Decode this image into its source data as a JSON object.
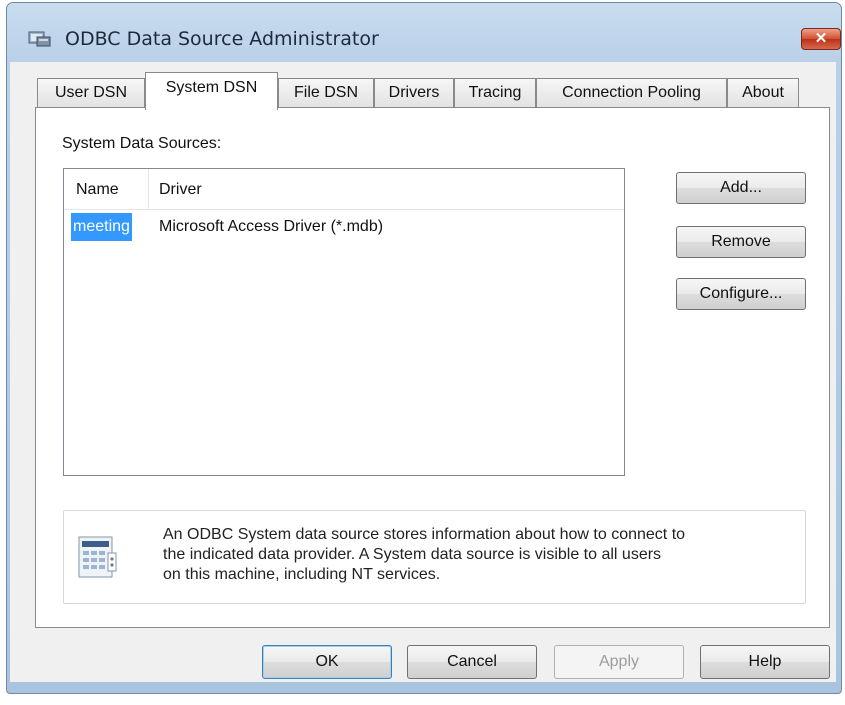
{
  "window": {
    "title": "ODBC Data Source Administrator",
    "close_label": "✕"
  },
  "tabs": [
    {
      "label": "User DSN",
      "active": false
    },
    {
      "label": "System DSN",
      "active": true
    },
    {
      "label": "File DSN",
      "active": false
    },
    {
      "label": "Drivers",
      "active": false
    },
    {
      "label": "Tracing",
      "active": false
    },
    {
      "label": "Connection Pooling",
      "active": false
    },
    {
      "label": "About",
      "active": false
    }
  ],
  "panel": {
    "group_label": "System Data Sources:",
    "columns": [
      "Name",
      "Driver"
    ],
    "rows": [
      {
        "name": "meeting",
        "driver": "Microsoft Access Driver (*.mdb)",
        "selected": true
      }
    ],
    "buttons": {
      "add": "Add...",
      "remove": "Remove",
      "configure": "Configure..."
    },
    "info": {
      "icon": "data-source-icon",
      "lines": [
        "An ODBC System data source stores information about how to connect to",
        "the indicated data provider.   A System data source is visible to all users",
        "on this machine, including NT services."
      ]
    }
  },
  "footer": {
    "ok": "OK",
    "cancel": "Cancel",
    "apply": "Apply",
    "help": "Help",
    "apply_enabled": false
  },
  "colors": {
    "selection": "#3399ff",
    "close_button": "#c8462a",
    "frame": "#b9d0e8"
  }
}
